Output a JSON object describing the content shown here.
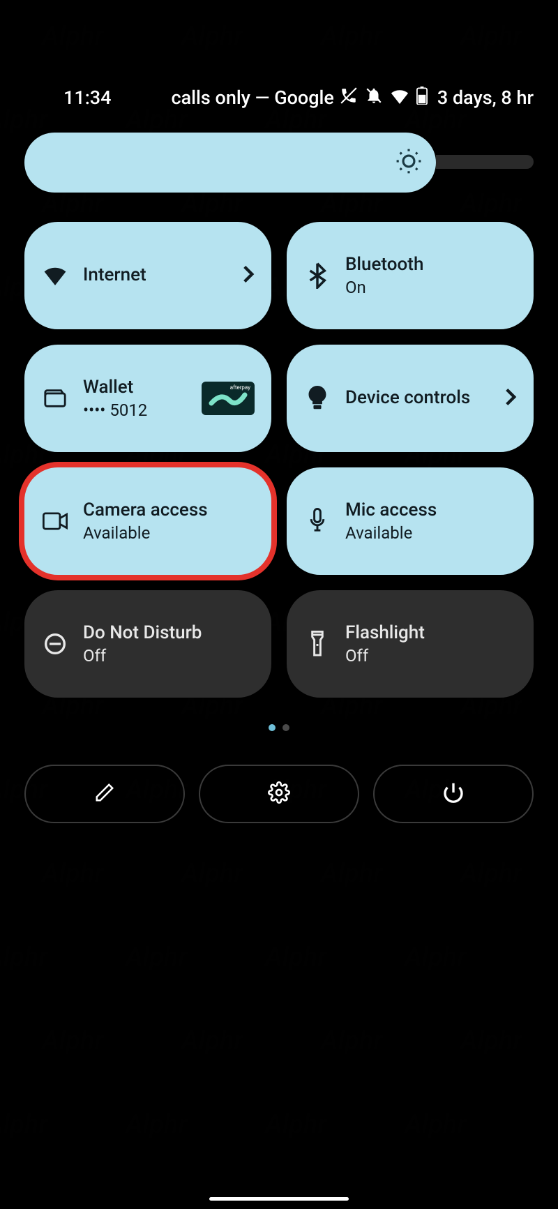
{
  "status": {
    "time": "11:34",
    "network_text": "calls only — Google",
    "battery_text": "3 days, 8 hr"
  },
  "brightness": {
    "level_pct": 81
  },
  "tiles": [
    {
      "id": "internet",
      "title": "Internet",
      "sub": "",
      "state": "active",
      "chevron": true
    },
    {
      "id": "bluetooth",
      "title": "Bluetooth",
      "sub": "On",
      "state": "active"
    },
    {
      "id": "wallet",
      "title": "Wallet",
      "sub": "•••• 5012",
      "state": "active",
      "card": true,
      "card_label": "afterpay"
    },
    {
      "id": "device-controls",
      "title": "Device controls",
      "sub": "",
      "state": "active",
      "chevron": true
    },
    {
      "id": "camera-access",
      "title": "Camera access",
      "sub": "Available",
      "state": "active",
      "highlight": true
    },
    {
      "id": "mic-access",
      "title": "Mic access",
      "sub": "Available",
      "state": "active"
    },
    {
      "id": "dnd",
      "title": "Do Not Disturb",
      "sub": "Off",
      "state": "inactive"
    },
    {
      "id": "flashlight",
      "title": "Flashlight",
      "sub": "Off",
      "state": "inactive"
    }
  ],
  "pagination": {
    "pages": 2,
    "current": 0
  },
  "watermark": "Alphr"
}
